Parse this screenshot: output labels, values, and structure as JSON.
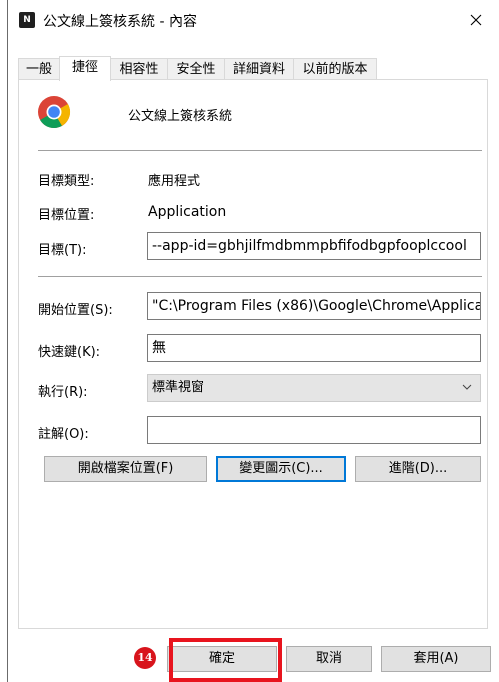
{
  "window": {
    "title": "公文線上簽核系統 - 內容",
    "icon_text": "N"
  },
  "tabs": [
    {
      "label": "一般"
    },
    {
      "label": "捷徑"
    },
    {
      "label": "相容性"
    },
    {
      "label": "安全性"
    },
    {
      "label": "詳細資料"
    },
    {
      "label": "以前的版本"
    }
  ],
  "header": {
    "app_name": "公文線上簽核系統"
  },
  "info": {
    "target_type_label": "目標類型:",
    "target_type_value": "應用程式",
    "target_location_label": "目標位置:",
    "target_location_value": "Application",
    "target_label": "目標(T):",
    "target_value": "--app-id=gbhjilfmdbmmpbfifodbgpfooplccool"
  },
  "fields": {
    "start_in_label": "開始位置(S):",
    "start_in_value": "\"C:\\Program Files (x86)\\Google\\Chrome\\Applica",
    "shortcut_key_label": "快速鍵(K):",
    "shortcut_key_value": "無",
    "run_label": "執行(R):",
    "run_value": "標準視窗",
    "comment_label": "註解(O):",
    "comment_value": ""
  },
  "actions": {
    "open_location": "開啟檔案位置(F)",
    "change_icon": "變更圖示(C)...",
    "advanced": "進階(D)..."
  },
  "footer": {
    "ok": "確定",
    "cancel": "取消",
    "apply": "套用(A)"
  },
  "annotation": {
    "step": "14",
    "color": "#e8141e"
  }
}
